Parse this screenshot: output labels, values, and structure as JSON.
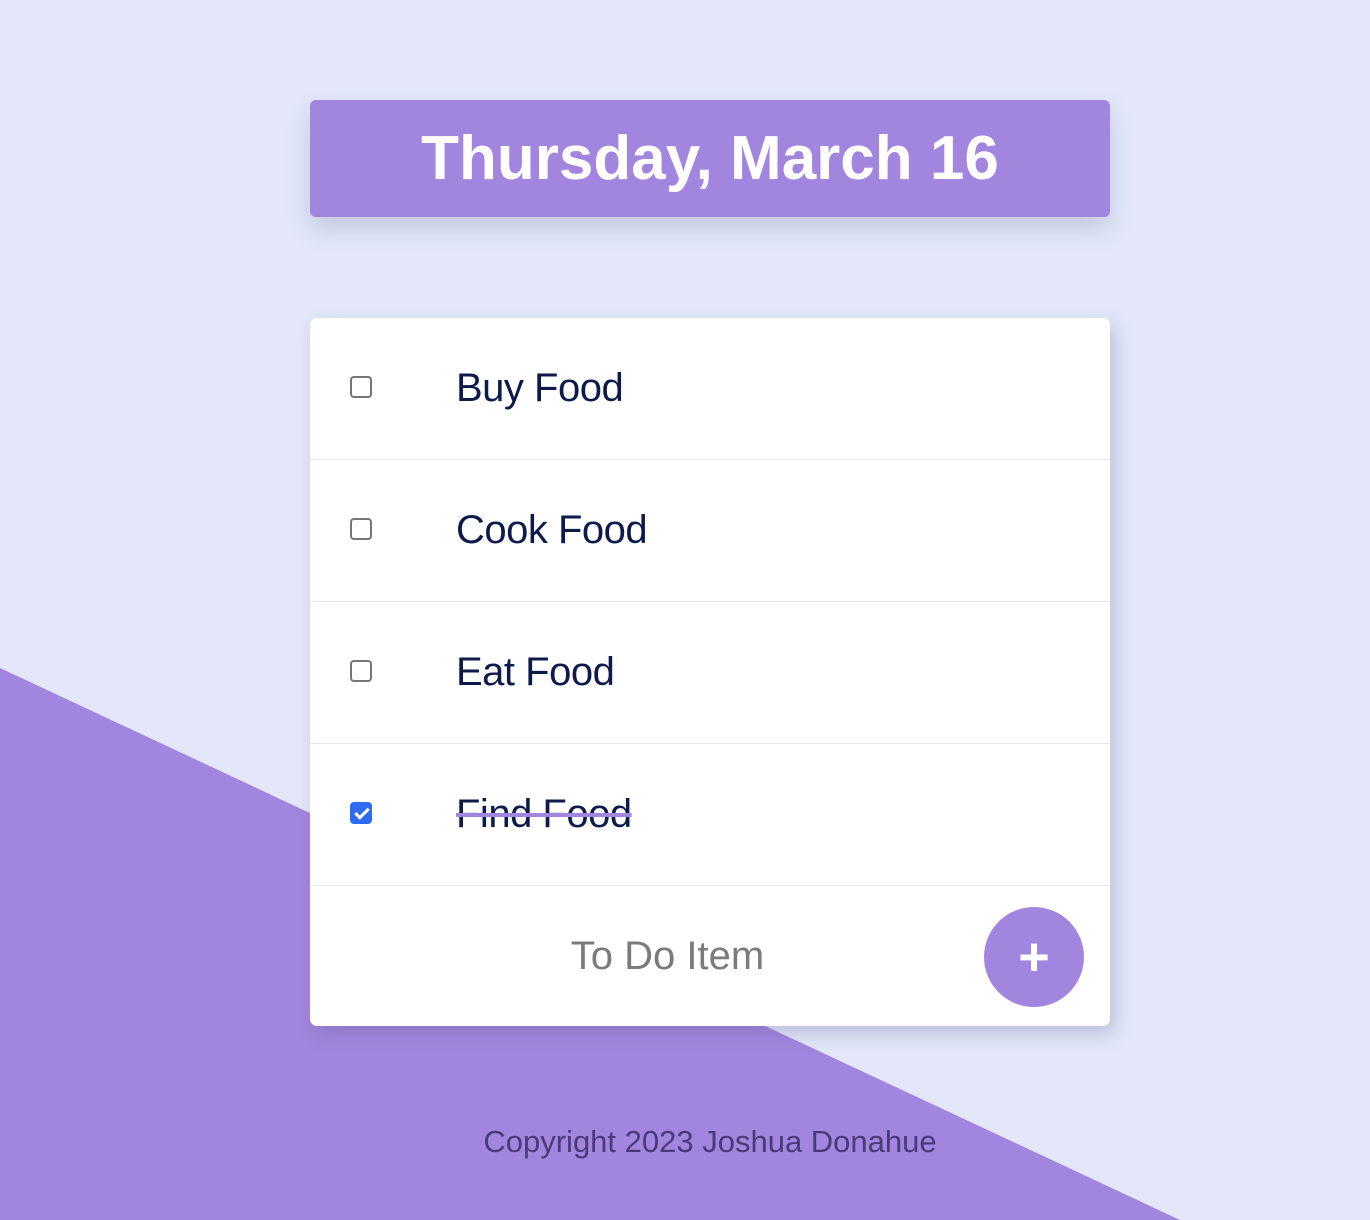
{
  "heading": {
    "date": "Thursday, March 16"
  },
  "todo_list": {
    "items": [
      {
        "label": "Buy Food",
        "checked": false
      },
      {
        "label": "Cook Food",
        "checked": false
      },
      {
        "label": "Eat Food",
        "checked": false
      },
      {
        "label": "Find Food",
        "checked": true
      }
    ],
    "new_item": {
      "placeholder": "To Do Item",
      "value": "",
      "add_label": "+"
    }
  },
  "footer": {
    "copyright": "Copyright 2023 Joshua Donahue"
  },
  "colors": {
    "background": "#e3e7f9",
    "accent": "#a285de",
    "item_text": "#0d1a4a",
    "checkbox_checked": "#2f6bf0"
  }
}
